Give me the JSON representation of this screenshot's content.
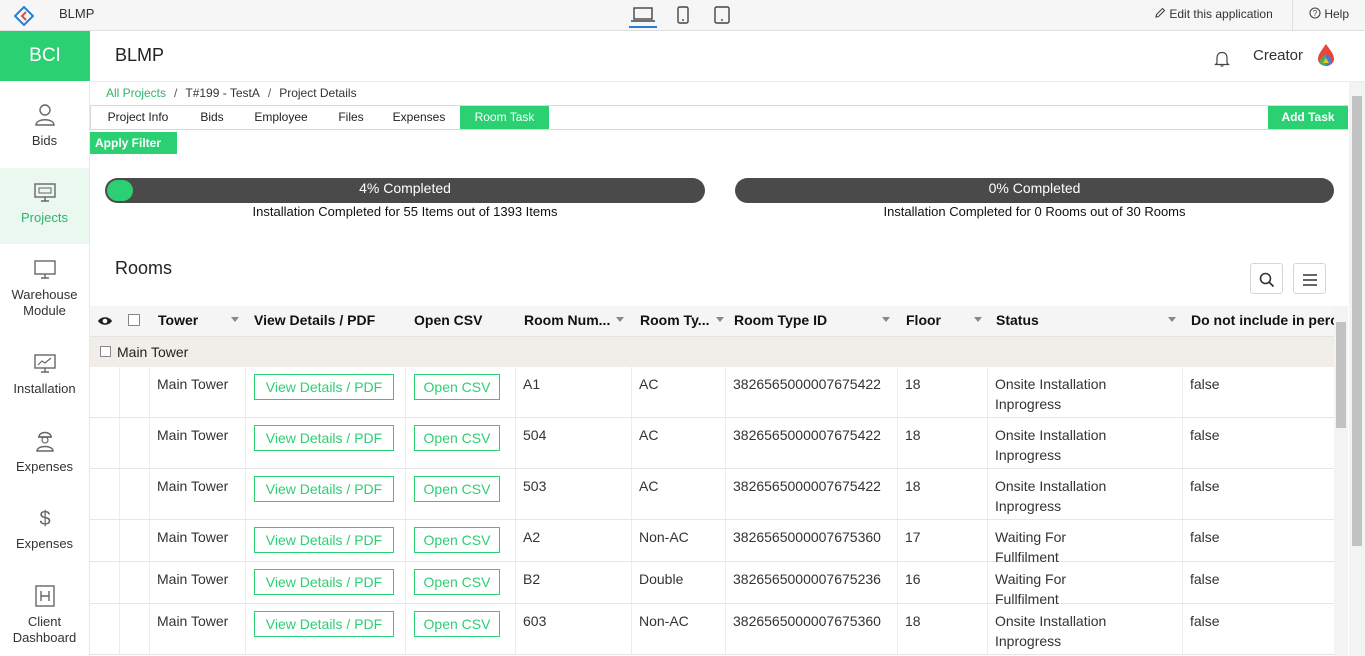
{
  "topbar": {
    "app_name": "BLMP",
    "edit_label": "Edit this application",
    "help_label": "Help"
  },
  "brand": "BCI",
  "sidebar": {
    "items": [
      {
        "label": "Bids",
        "icon": "user-icon"
      },
      {
        "label": "Projects",
        "icon": "monitor-icon"
      },
      {
        "label": "Warehouse Module",
        "icon": "monitor-icon"
      },
      {
        "label": "Installation",
        "icon": "chart-monitor-icon"
      },
      {
        "label": "Expenses",
        "icon": "worker-icon"
      },
      {
        "label": "Expenses",
        "icon": "dollar-icon"
      },
      {
        "label": "Client Dashboard",
        "icon": "building-icon"
      }
    ]
  },
  "header": {
    "title": "BLMP",
    "user": "Creator"
  },
  "breadcrumb": {
    "items": [
      "All Projects",
      "T#199 - TestA",
      "Project Details"
    ]
  },
  "tabs": [
    "Project Info",
    "Bids",
    "Employee",
    "Files",
    "Expenses",
    "Room Task"
  ],
  "add_task": "Add Task",
  "apply_filter": "Apply Filter",
  "progress": [
    {
      "label": "4% Completed",
      "fraction": 0.04,
      "caption": "Installation Completed for 55 Items out of 1393 Items"
    },
    {
      "label": "0% Completed",
      "fraction": 0.0,
      "caption": "Installation Completed for 0 Rooms out of 30 Rooms"
    }
  ],
  "rooms": {
    "title": "Rooms",
    "columns": [
      "Tower",
      "View Details / PDF",
      "Open CSV",
      "Room Num...",
      "Room Ty...",
      "Room Type ID",
      "Floor",
      "Status",
      "Do not include in perce"
    ],
    "group": "Main Tower",
    "rows": [
      {
        "tower": "Main Tower",
        "view": "View Details / PDF",
        "csv": "Open CSV",
        "room": "A1",
        "type": "AC",
        "type_id": "3826565000007675422",
        "floor": "18",
        "status": "Onsite Installation Inprogress",
        "exclude": "false"
      },
      {
        "tower": "Main Tower",
        "view": "View Details / PDF",
        "csv": "Open CSV",
        "room": "504",
        "type": "AC",
        "type_id": "3826565000007675422",
        "floor": "18",
        "status": "Onsite Installation Inprogress",
        "exclude": "false"
      },
      {
        "tower": "Main Tower",
        "view": "View Details / PDF",
        "csv": "Open CSV",
        "room": "503",
        "type": "AC",
        "type_id": "3826565000007675422",
        "floor": "18",
        "status": "Onsite Installation Inprogress",
        "exclude": "false"
      },
      {
        "tower": "Main Tower",
        "view": "View Details / PDF",
        "csv": "Open CSV",
        "room": "A2",
        "type": "Non-AC",
        "type_id": "3826565000007675360",
        "floor": "17",
        "status": "Waiting For Fullfilment",
        "exclude": "false"
      },
      {
        "tower": "Main Tower",
        "view": "View Details / PDF",
        "csv": "Open CSV",
        "room": "B2",
        "type": "Double",
        "type_id": "3826565000007675236",
        "floor": "16",
        "status": "Waiting For Fullfilment",
        "exclude": "false"
      },
      {
        "tower": "Main Tower",
        "view": "View Details / PDF",
        "csv": "Open CSV",
        "room": "603",
        "type": "Non-AC",
        "type_id": "3826565000007675360",
        "floor": "18",
        "status": "Onsite Installation Inprogress",
        "exclude": "false"
      }
    ]
  },
  "colors": {
    "accent": "#2bd073",
    "dark": "#4a4a4a"
  }
}
